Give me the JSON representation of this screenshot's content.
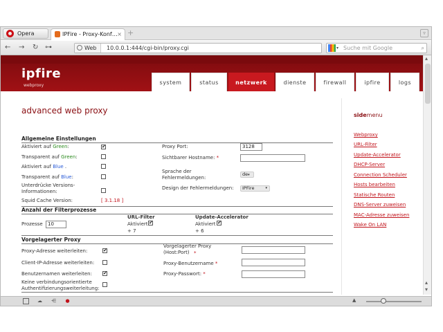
{
  "browser": {
    "opera_label": "Opera",
    "tab_title": "IPFire - Proxy-Konf…",
    "tab_close": "×",
    "newtab": "+",
    "corner": "▿",
    "back": "←",
    "forward": "→",
    "reload": "↻",
    "key": "⊶",
    "web_tag": "Web",
    "url": "10.0.0.1:444/cgi-bin/proxy.cgi",
    "search_placeholder": "Suche mit Google",
    "search_engine_icon": "google-icon",
    "search_arrow": "▾",
    "search_glass": "⌕"
  },
  "header": {
    "logo": "ipfire",
    "logo_sub": "webproxy"
  },
  "menu": [
    "system",
    "status",
    "netzwerk",
    "dienste",
    "firewall",
    "ipfire",
    "logs"
  ],
  "page": {
    "title": "advanced web proxy"
  },
  "side": {
    "h1": "side",
    "h2": "menu",
    "links": [
      "Webproxy",
      "URL-Filter",
      "Update-Accelerator",
      "DHCP-Server",
      "Connection Scheduler",
      "Hosts bearbeiten",
      "Statische Routen",
      "DNS-Server zuweisen",
      "MAC-Adresse zuweisen",
      "Wake On LAN"
    ]
  },
  "general": {
    "title": "Allgemeine Einstellungen",
    "aktiv_a": "Aktiviert auf ",
    "green": "Green",
    "colon": ":",
    "transp_a": "Transparent auf ",
    "blue": "Blue",
    "aktiv_b_sep": " .",
    "suppress": "Unterdrücke Versions-Informationen:",
    "squid_label": "Squid Cache Version:",
    "squid_val": "[ 3.1.18 ]",
    "port_label": "Proxy Port:",
    "port_val": "3128",
    "host_label": "Sichtbarer Hostname:",
    "star": "*",
    "lang_label": "Sprache der Fehlermeldungen:",
    "lang_val": "de",
    "design_label": "Design der Fehlermeldungen:",
    "design_val": "IPFire"
  },
  "filter": {
    "title": "Anzahl der Filterprozesse",
    "proc_label": "Prozesse",
    "proc_val": "10",
    "url_title": "URL-Filter",
    "upd_title": "Update-Accelerator",
    "aktiv": "Aktiviert",
    "plus7": "+ 7",
    "plus6": "+ 6"
  },
  "upstream": {
    "title": "Vorgelagerter Proxy",
    "fwd_proxy": "Proxy-Adresse weiterleiten:",
    "fwd_client": "Client-IP-Adresse weiterleiten:",
    "fwd_user": "Benutzernamen weiterleiten:",
    "no_conn": "Keine verbindungsorientierte Authentifizierungsweiterleitung:",
    "up_host": "Vorgelagerter Proxy (Host:Port)",
    "up_user": "Proxy-Benutzername",
    "up_pass": "Proxy-Passwort:",
    "star": "*"
  },
  "statusbar": {
    "zoom_arrow": "▲"
  }
}
